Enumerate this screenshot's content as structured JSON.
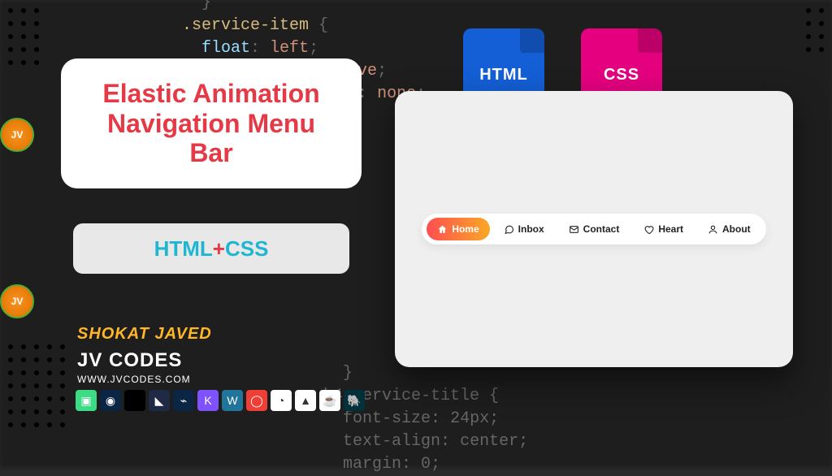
{
  "title": {
    "line1": "Elastic Animation",
    "line2": "Navigation Menu",
    "line3": "Bar"
  },
  "subtitle": {
    "html": "HTML",
    "plus": "+",
    "css": "CSS"
  },
  "author": "SHOKAT JAVED",
  "site_name": "JV CODES",
  "site_url": "WWW.JVCODES.COM",
  "file_icons": {
    "html": "HTML",
    "css": "CSS"
  },
  "nav_items": [
    {
      "label": "Home",
      "icon": "home",
      "active": true
    },
    {
      "label": "Inbox",
      "icon": "chat",
      "active": false
    },
    {
      "label": "Contact",
      "icon": "mail",
      "active": false
    },
    {
      "label": "Heart",
      "icon": "heart",
      "active": false
    },
    {
      "label": "About",
      "icon": "user",
      "active": false
    }
  ],
  "tech_icons": [
    {
      "name": "android",
      "bg": "#3ddc84",
      "glyph": "▣"
    },
    {
      "name": "html5",
      "bg": "#0b2545",
      "glyph": "◉"
    },
    {
      "name": "apple",
      "bg": "#000000",
      "glyph": ""
    },
    {
      "name": "flutter",
      "bg": "#1f2a44",
      "glyph": "◣"
    },
    {
      "name": "vscode",
      "bg": "#0b2545",
      "glyph": "⌁"
    },
    {
      "name": "kotlin",
      "bg": "#7f52ff",
      "glyph": "K"
    },
    {
      "name": "wordpress",
      "bg": "#21759b",
      "glyph": "W"
    },
    {
      "name": "opensrc",
      "bg": "#ef3e36",
      "glyph": "◯"
    },
    {
      "name": "git",
      "bg": "#ffffff",
      "glyph": "◔"
    },
    {
      "name": "firebase",
      "bg": "#ffffff",
      "glyph": "▲"
    },
    {
      "name": "java",
      "bg": "#ffffff",
      "glyph": "☕"
    },
    {
      "name": "gradle",
      "bg": "#02303a",
      "glyph": "🐘"
    }
  ],
  "jv_badge": "JV"
}
